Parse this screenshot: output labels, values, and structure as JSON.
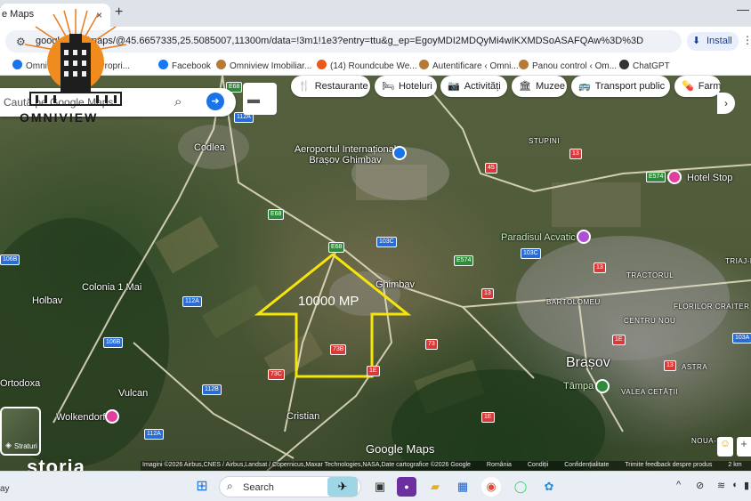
{
  "browser": {
    "tab_title": "e Maps",
    "tab_close": "×",
    "new_tab": "+",
    "minimize": "—",
    "url": "google.com/maps/@45.6657335,25.5085007,11300m/data=!3m1!1e3?entry=ttu&g_ep=EgoyMDI2MDQyMi4wIKXMDSoASAFQAw%3D%3D",
    "install_label": "Install",
    "bookmarks": [
      {
        "label": "Omniview",
        "color": "#1a73e8"
      },
      {
        "label": "Propri...",
        "color": "#d44"
      },
      {
        "label": "Facebook",
        "color": "#1877f2"
      },
      {
        "label": "Omniview Imobiliar...",
        "color": "#b87a30"
      },
      {
        "label": "(14) Roundcube We...",
        "color": "#e8591a"
      },
      {
        "label": "Autentificare ‹ Omni...",
        "color": "#b87a30"
      },
      {
        "label": "Panou control ‹ Om...",
        "color": "#b87a30"
      },
      {
        "label": "ChatGPT",
        "color": "#333333"
      }
    ]
  },
  "map": {
    "search_placeholder": "Caută pe Google Maps",
    "chips": [
      {
        "icon": "🍴",
        "label": "Restaurante"
      },
      {
        "icon": "🛏",
        "label": "Hoteluri"
      },
      {
        "icon": "📷",
        "label": "Activități"
      },
      {
        "icon": "🏛",
        "label": "Muzee"
      },
      {
        "icon": "🚌",
        "label": "Transport public"
      },
      {
        "icon": "💊",
        "label": "Farm"
      }
    ],
    "chip_next": "›",
    "places": {
      "codlea": "Codlea",
      "airport": "Aeroportul Internațional Brașov Ghimbav",
      "stupini": "STUPINI",
      "hotel_stop": "Hotel Stop",
      "paradisul": "Paradisul Acvatic",
      "triaj": "TRIAJ-H",
      "colonia": "Colonia 1 Mai",
      "holbav": "Holbav",
      "ghimbav": "Ghimbav",
      "tractorul": "TRACTORUL",
      "bartolomeu": "BARTOLOMEU",
      "centru_nou": "CENTRU NOU",
      "florilor": "FLORILOR CRAITER",
      "brasov": "Brașov",
      "ortodoxa": "Ortodoxa",
      "tampa": "Tâmpa",
      "valea": "VALEA CETĂȚII",
      "astra": "ASTRA",
      "vulcan": "Vulcan",
      "wolkendorf": "Wolkendorf",
      "cristian": "Cristian",
      "noua": "NOUA-D"
    },
    "roads": [
      "E68",
      "112A",
      "E68",
      "45",
      "13",
      "E574",
      "E68",
      "103C",
      "E574",
      "103C",
      "13",
      "106B",
      "112A",
      "106B",
      "13",
      "73B",
      "73",
      "1E",
      "73C",
      "112B",
      "13",
      "103A",
      "1E",
      "112A",
      "1E"
    ],
    "arrow_label": "10000 MP",
    "layers_label": "Straturi",
    "google_logo": "Google Maps",
    "attribution": [
      "Imagini ©2026 Airbus,CNES / Airbus,Landsat / Copernicus,Maxar Technologies,NASA,Date cartografice ©2026 Google",
      "România",
      "Condiții",
      "Confidențialitate",
      "Trimite feedback despre produs",
      "2 km"
    ],
    "arrow_color": "#f5e50a"
  },
  "watermark": {
    "omniview": "OMNIVIEW",
    "storia": "storia"
  },
  "taskbar": {
    "left_text": "ay",
    "search_label": "Search",
    "icons": [
      "windows-logo",
      "search",
      "game",
      "file-explorer",
      "folder",
      "store",
      "chrome",
      "whatsapp",
      "app"
    ],
    "tray": [
      "^",
      "⊘",
      "wifi",
      "volume",
      "battery"
    ]
  }
}
